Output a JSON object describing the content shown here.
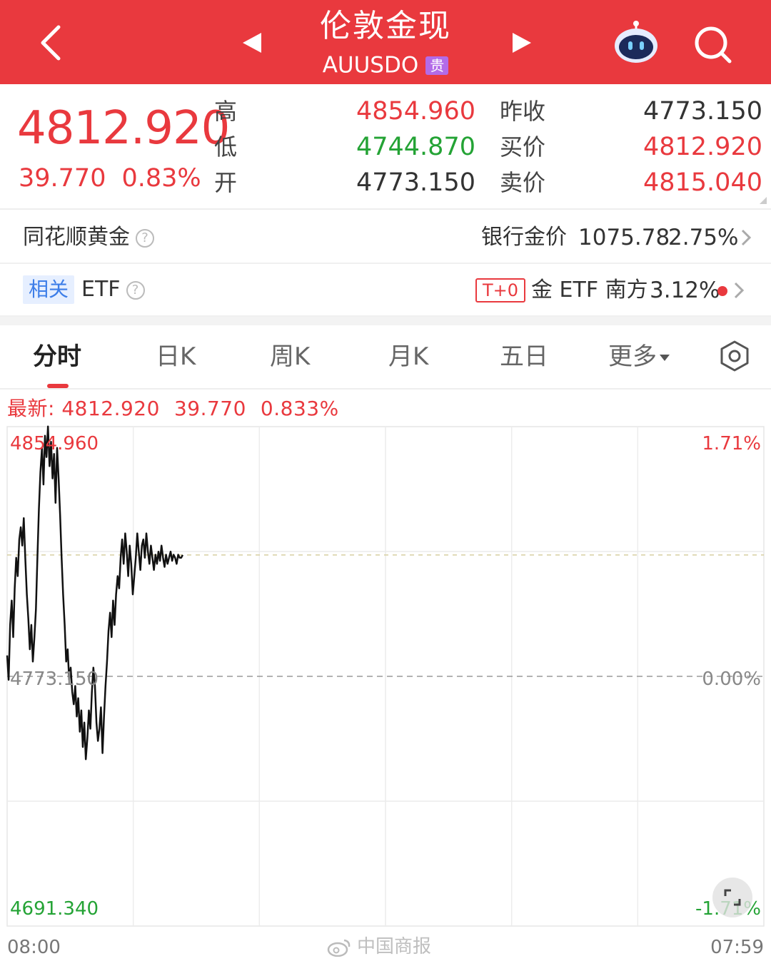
{
  "header": {
    "title": "伦敦金现",
    "code": "AUUSDO",
    "badge": "贵",
    "bg_color": "#e9393e"
  },
  "quote": {
    "price": "4812.920",
    "change": "39.770",
    "change_pct": "0.83%",
    "high_label": "高",
    "low_label": "低",
    "open_label": "开",
    "high": "4854.960",
    "low": "4744.870",
    "open": "4773.150",
    "prev_close_label": "昨收",
    "bid_label": "买价",
    "ask_label": "卖价",
    "prev_close": "4773.150",
    "bid": "4812.920",
    "ask": "4815.040"
  },
  "gold_row": {
    "label": "同花顺黄金",
    "help": "?",
    "bank_label": "银行金价",
    "bank_price": "1075.78",
    "bank_pct": "2.75%"
  },
  "etf_row": {
    "tag": "相关",
    "label": "ETF",
    "help": "?",
    "t0_tag": "T+0",
    "etf_name": "金 ETF 南方",
    "etf_pct": "3.12%"
  },
  "tabs": [
    "分时",
    "日K",
    "周K",
    "月K",
    "五日"
  ],
  "more_label": "更多",
  "latest": {
    "prefix": "最新: 4812.920",
    "change": "39.770",
    "pct": "0.833%"
  },
  "chart_data": {
    "type": "line",
    "title": "",
    "xlabel": "",
    "ylabel": "",
    "x_start_label": "08:00",
    "x_end_label": "07:59",
    "y_top_label": "4854.960",
    "y_mid_label": "4773.150",
    "y_bottom_label": "4691.340",
    "pct_top_label": "1.71%",
    "pct_mid_label": "0.00%",
    "pct_bottom_label": "-1.71%",
    "ylim": [
      4691.34,
      4854.96
    ],
    "reference_value": 4773.15,
    "current_value": 4812.92,
    "session_fraction_start": 0,
    "session_fraction_end": 1,
    "series": [
      {
        "t": [
          0.0,
          0.002,
          0.004,
          0.006,
          0.008,
          0.01,
          0.012,
          0.014,
          0.016,
          0.018,
          0.02,
          0.022,
          0.024,
          0.026,
          0.028,
          0.03,
          0.032,
          0.034,
          0.036,
          0.038,
          0.04,
          0.042,
          0.044,
          0.046,
          0.048,
          0.05,
          0.052,
          0.054,
          0.056,
          0.058,
          0.06,
          0.062,
          0.064,
          0.066,
          0.068,
          0.07,
          0.072,
          0.074,
          0.076,
          0.078,
          0.08,
          0.082,
          0.084,
          0.086,
          0.088,
          0.09,
          0.092,
          0.094,
          0.096,
          0.098,
          0.1,
          0.102,
          0.104,
          0.106,
          0.108,
          0.11,
          0.112,
          0.114,
          0.116,
          0.118,
          0.12,
          0.122,
          0.124,
          0.126,
          0.128,
          0.13,
          0.132,
          0.134,
          0.136,
          0.138,
          0.14,
          0.142,
          0.144,
          0.146,
          0.148,
          0.15,
          0.152,
          0.154,
          0.156,
          0.158,
          0.16,
          0.162,
          0.164,
          0.166,
          0.168,
          0.17,
          0.172,
          0.174,
          0.176,
          0.178,
          0.18,
          0.182,
          0.184,
          0.186,
          0.188,
          0.19,
          0.192,
          0.194,
          0.196,
          0.198,
          0.2,
          0.202,
          0.204,
          0.206,
          0.208,
          0.21,
          0.212,
          0.214,
          0.216,
          0.218,
          0.22,
          0.222,
          0.224,
          0.226,
          0.228,
          0.23,
          0.232,
          0.234
        ],
        "y": [
          4780,
          4772,
          4790,
          4798,
          4786,
          4802,
          4812,
          4806,
          4818,
          4822,
          4816,
          4825,
          4812,
          4800,
          4792,
          4782,
          4790,
          4778,
          4786,
          4795,
          4812,
          4828,
          4840,
          4848,
          4836,
          4852,
          4845,
          4855,
          4842,
          4850,
          4838,
          4846,
          4830,
          4848,
          4838,
          4826,
          4812,
          4800,
          4790,
          4778,
          4782,
          4772,
          4776,
          4768,
          4764,
          4770,
          4760,
          4766,
          4755,
          4762,
          4750,
          4758,
          4746,
          4753,
          4762,
          4756,
          4768,
          4776,
          4770,
          4758,
          4752,
          4756,
          4763,
          4748,
          4760,
          4770,
          4778,
          4788,
          4794,
          4786,
          4798,
          4790,
          4800,
          4806,
          4802,
          4812,
          4818,
          4810,
          4820,
          4814,
          4806,
          4816,
          4810,
          4800,
          4806,
          4812,
          4820,
          4814,
          4808,
          4816,
          4818,
          4812,
          4820,
          4814,
          4810,
          4816,
          4812,
          4808,
          4813,
          4810,
          4814,
          4811,
          4816,
          4812,
          4809,
          4813,
          4810,
          4812,
          4814,
          4811,
          4813,
          4812,
          4810,
          4813,
          4812,
          4812,
          4812.92
        ]
      }
    ],
    "grid": true,
    "line_color": "#111111",
    "up_color": "#e9393e",
    "down_color": "#24a335"
  },
  "watermark": "中国商报"
}
